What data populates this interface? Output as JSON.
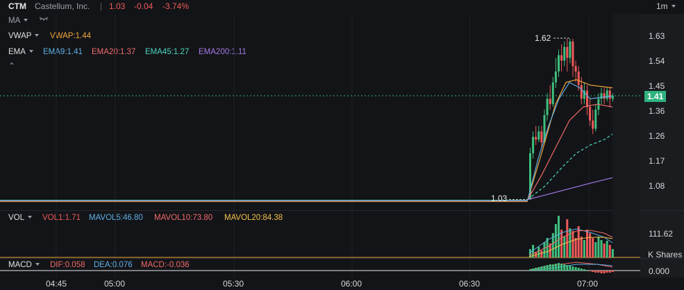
{
  "header": {
    "ticker": "CTM",
    "company": "Castellum, Inc.",
    "price": "1.03",
    "change": "-0.04",
    "change_pct": "-3.74%",
    "interval": "1m"
  },
  "indicators": {
    "ma_label": "MA",
    "vwap_label": "VWAP",
    "vwap_value": "VWAP:1.44",
    "ema_label": "EMA",
    "ema9": "EMA9:1.41",
    "ema20": "EMA20:1.37",
    "ema45": "EMA45:1.27",
    "ema200": "EMA200:1.11"
  },
  "price_axis": [
    "1.63",
    "1.54",
    "1.45",
    "1.36",
    "1.26",
    "1.17",
    "1.08"
  ],
  "current_price_tag": "1.41",
  "annotations": {
    "high": "1.62",
    "low": "1.03"
  },
  "vol_panel": {
    "label": "VOL",
    "vol1": "VOL1:1.71",
    "mavol5": "MAVOL5:46.80",
    "mavol10": "MAVOL10:73.80",
    "mavol20": "MAVOL20:84.38",
    "axis_value": "111.62",
    "axis_unit": "K Shares"
  },
  "macd_panel": {
    "label": "MACD",
    "dif": "DIF:0.058",
    "dea": "DEA:0.076",
    "macd": "MACD:-0.036",
    "axis_value": "0.000"
  },
  "time_axis": [
    "04:45",
    "05:00",
    "05:30",
    "06:00",
    "06:30",
    "07:00"
  ],
  "colors": {
    "up": "#3fbf7f",
    "down": "#f05a5a",
    "vwap": "#f2a93b",
    "ema9": "#5fb0e6",
    "ema20": "#f06a6a",
    "ema45": "#4dd8c0",
    "ema200": "#a37ae8"
  }
}
